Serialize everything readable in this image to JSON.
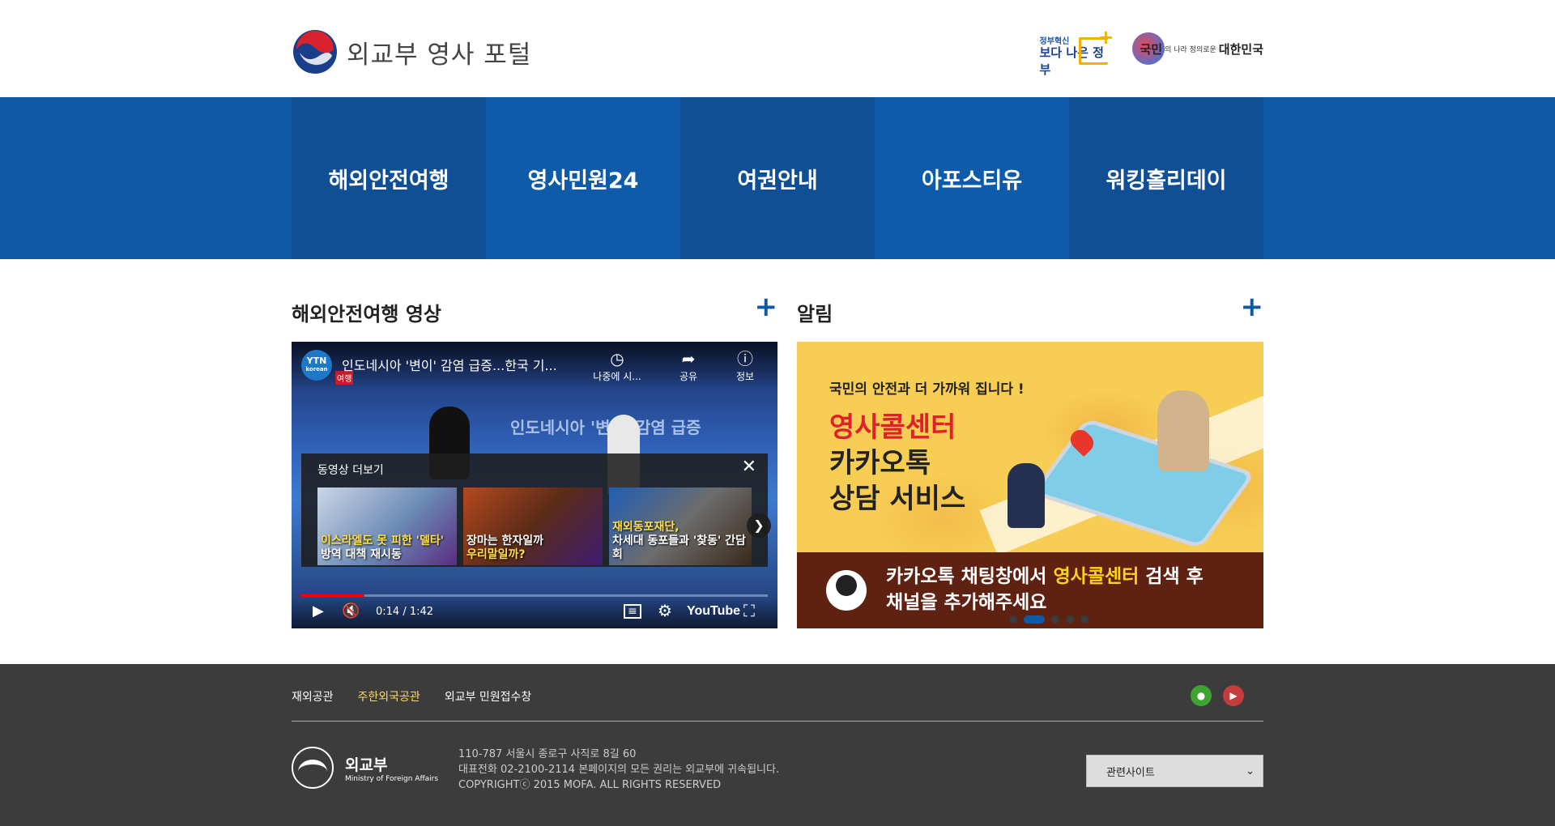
{
  "header": {
    "logo_text": "외교부 영사 포털",
    "badge1_small": "정부혁신",
    "badge1_big": "보다 나은 정부",
    "badge2_t1": "국민",
    "badge2_t2": "의 나라 정의로운",
    "badge2_t3": "대한민국"
  },
  "nav": {
    "items": [
      {
        "label": "해외안전여행"
      },
      {
        "label": "영사민원24"
      },
      {
        "label": "여권안내"
      },
      {
        "label": "아포스티유"
      },
      {
        "label": "워킹홀리데이"
      }
    ]
  },
  "video_section": {
    "title": "해외안전여행 영상",
    "more": "+",
    "video": {
      "channel": "YTN",
      "channel_sub": "korean",
      "title": "인도네시아 '변이' 감염 급증...한국 기...",
      "tag": "여행",
      "screen_text": "인도네시아 '변이' 감염 급증",
      "controls": {
        "watch_later": "나중에 시...",
        "share": "공유",
        "info": "정보"
      },
      "more_videos_title": "동영상 더보기",
      "thumbs": [
        {
          "line1": "이스라엘도 못 피한 '델타'",
          "line2": "방역 대책 재시동"
        },
        {
          "line1": "장마는 한자일까",
          "line2": "우리말일까?"
        },
        {
          "line1": "재외동포재단,",
          "line2": "차세대 동포들과 '찾동' 간담회"
        }
      ],
      "time": "0:14 / 1:42",
      "progress": 0.136,
      "youtube_label": "YouTube"
    }
  },
  "notice_section": {
    "title": "알림",
    "more": "+",
    "banner": {
      "sub": "국민의 안전과 더 가까워 집니다 !",
      "line1": "영사콜센터",
      "line2": "카카오톡",
      "line3": "상담 서비스",
      "bottom_pre": "카카오톡 채팅창에서 ",
      "bottom_hl": "영사콜센터",
      "bottom_post": " 검색 후",
      "bottom_line2": "채널을 추가해주세요"
    }
  },
  "footer": {
    "links": [
      {
        "label": "재외공관"
      },
      {
        "label": "주한외국공관"
      },
      {
        "label": "외교부 민원접수창"
      }
    ],
    "logo_kr": "외교부",
    "logo_en": "Ministry of Foreign Affairs",
    "address": "110-787 서울시 종로구 사직로 8길 60",
    "phone": "대표전화 02-2100-2114 본페이지의 모든 권리는 외교부에 귀속됩니다.",
    "copyright": "COPYRIGHTⓒ 2015 MOFA. ALL RIGHTS RESERVED",
    "select_label": "관련사이트"
  },
  "colors": {
    "nav_bg": "#0e5aa7",
    "accent": "#0e5aa7",
    "footer_bg": "#3c3c3c"
  }
}
